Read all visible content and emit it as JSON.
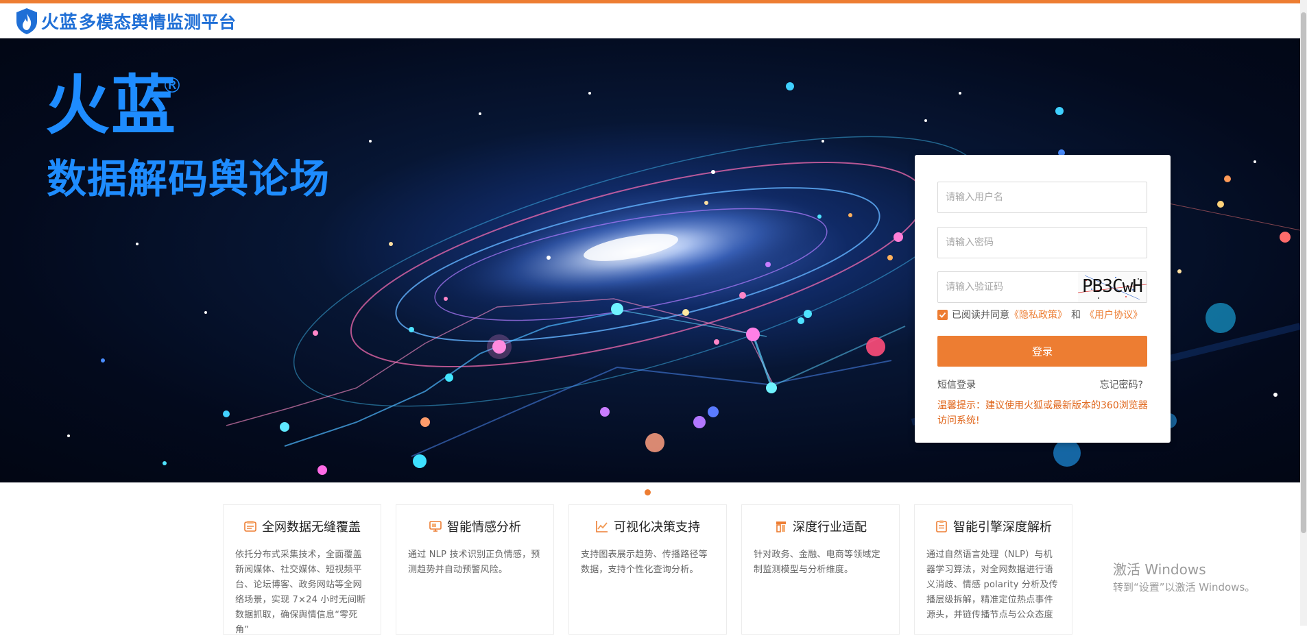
{
  "header": {
    "brand": "火蓝",
    "title": "多模态舆情监测平台"
  },
  "hero": {
    "brand": "火蓝",
    "registered_mark": "®",
    "slogan": "数据解码舆论场"
  },
  "login": {
    "username_placeholder": "请输入用户名",
    "password_placeholder": "请输入密码",
    "captcha_placeholder": "请输入验证码",
    "captcha_text": "PB3CwH",
    "agree_text": "已阅读并同意",
    "privacy_link": "《隐私政策》",
    "and_text": "和",
    "terms_link": "《用户协议》",
    "login_button": "登录",
    "sms_login": "短信登录",
    "forgot_password": "忘记密码?",
    "tip": "温馨提示：建议使用火狐或最新版本的360浏览器访问系统!"
  },
  "features": [
    {
      "icon": "database-icon",
      "title": "全网数据无缝覆盖",
      "desc": "依托分布式采集技术，全面覆盖新闻媒体、社交媒体、短视频平台、论坛博客、政务网站等全网络场景，实现 7×24 小时无间断数据抓取，确保舆情信息“零死角”"
    },
    {
      "icon": "monitor-icon",
      "title": "智能情感分析",
      "desc": "通过 NLP 技术识别正负情感，预测趋势并自动预警风险。"
    },
    {
      "icon": "chart-line-icon",
      "title": "可视化决策支持",
      "desc": "支持图表展示趋势、传播路径等数据，支持个性化查询分析。"
    },
    {
      "icon": "industry-icon",
      "title": "深度行业适配",
      "desc": "针对政务、金融、电商等领域定制监测模型与分析维度。"
    },
    {
      "icon": "clipboard-icon",
      "title": "智能引擎深度解析",
      "desc": "通过自然语言处理（NLP）与机器学习算法，对全网数据进行语义消歧、情感 polarity 分析及传播层级拆解，精准定位热点事件源头，并链传播节点与公众态度"
    }
  ],
  "watermark": {
    "line1": "激活 Windows",
    "line2": "转到“设置”以激活 Windows。"
  },
  "colors": {
    "accent": "#ED7D32",
    "brand_blue": "#1E8CFF",
    "header_blue": "#1F6FD6"
  }
}
